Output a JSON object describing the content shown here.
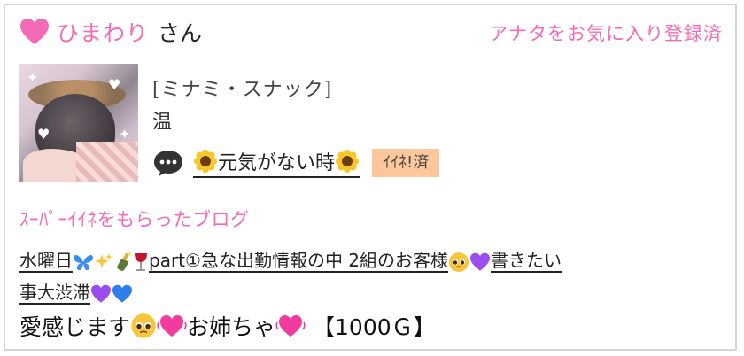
{
  "header": {
    "name": "ひまわり",
    "suffix": "さん",
    "favorite_status": "アナタをお気に入り登録済"
  },
  "profile": {
    "shop": "[ミナミ・スナック]",
    "role": "温",
    "status_text": "元気がない時",
    "iine_badge": "ｲｲﾈ!済"
  },
  "blog": {
    "section_title": "ｽｰﾊﾟｰｲｲﾈをもらったブログ",
    "title_line1_a": "水曜日",
    "title_line1_b": "part①急な出勤情報の中 2組のお客様",
    "title_line1_c": "書きたい",
    "title_line2": "事大渋滞"
  },
  "message": {
    "part1": "愛感じます",
    "part2": "お姉ちゃ",
    "amount": "【1000Ｇ】"
  },
  "colors": {
    "accent_pink": "#f36bb4",
    "badge_bg": "#fbc79b"
  },
  "icons": [
    "heart-icon",
    "chat-bubble-icon",
    "sunflower-icon",
    "butterfly-icon",
    "sparkles-icon",
    "champagne-icon",
    "wine-glass-icon",
    "pleading-face-icon",
    "purple-heart-icon",
    "blue-heart-icon",
    "beating-heart-icon"
  ]
}
